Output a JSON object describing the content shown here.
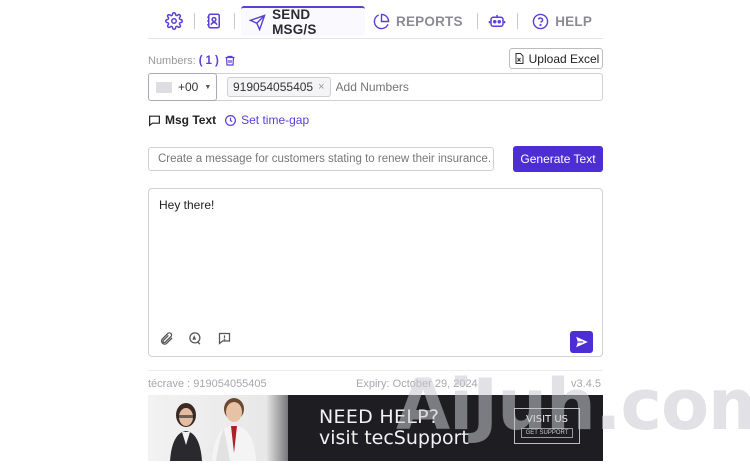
{
  "nav": {
    "tabs": [
      {
        "label": "SEND MSG/S",
        "icon": "send-icon",
        "active": true
      },
      {
        "label": "REPORTS",
        "icon": "pie-chart-icon",
        "active": false
      },
      {
        "label": "HELP",
        "icon": "help-circle-icon",
        "active": false
      }
    ]
  },
  "numbers": {
    "label": "Numbers:",
    "count_open": "(",
    "count": "1",
    "count_close": ")",
    "upload_label": "Upload Excel",
    "country_code": "+00",
    "chips": [
      "919054055405"
    ],
    "add_placeholder": "Add Numbers"
  },
  "options": {
    "msg_text": "Msg Text",
    "time_gap": "Set time-gap"
  },
  "generator": {
    "prompt": "Create a message for customers stating to renew their insurance.",
    "button": "Generate Text"
  },
  "message": {
    "text": "Hey there!"
  },
  "footer": {
    "user": "técrave : 919054055405",
    "expiry": "Expiry: October 29, 2024",
    "version": "v3.4.5"
  },
  "banner": {
    "line1": "NEED HELP?",
    "line2": "visit tecSupport",
    "visit_label": "VISIT US",
    "support_label": "GET SUPPORT"
  },
  "watermark": "AiJuh.com",
  "colors": {
    "accent": "#4c2ed4",
    "icon_accent": "#5b3fd9"
  }
}
